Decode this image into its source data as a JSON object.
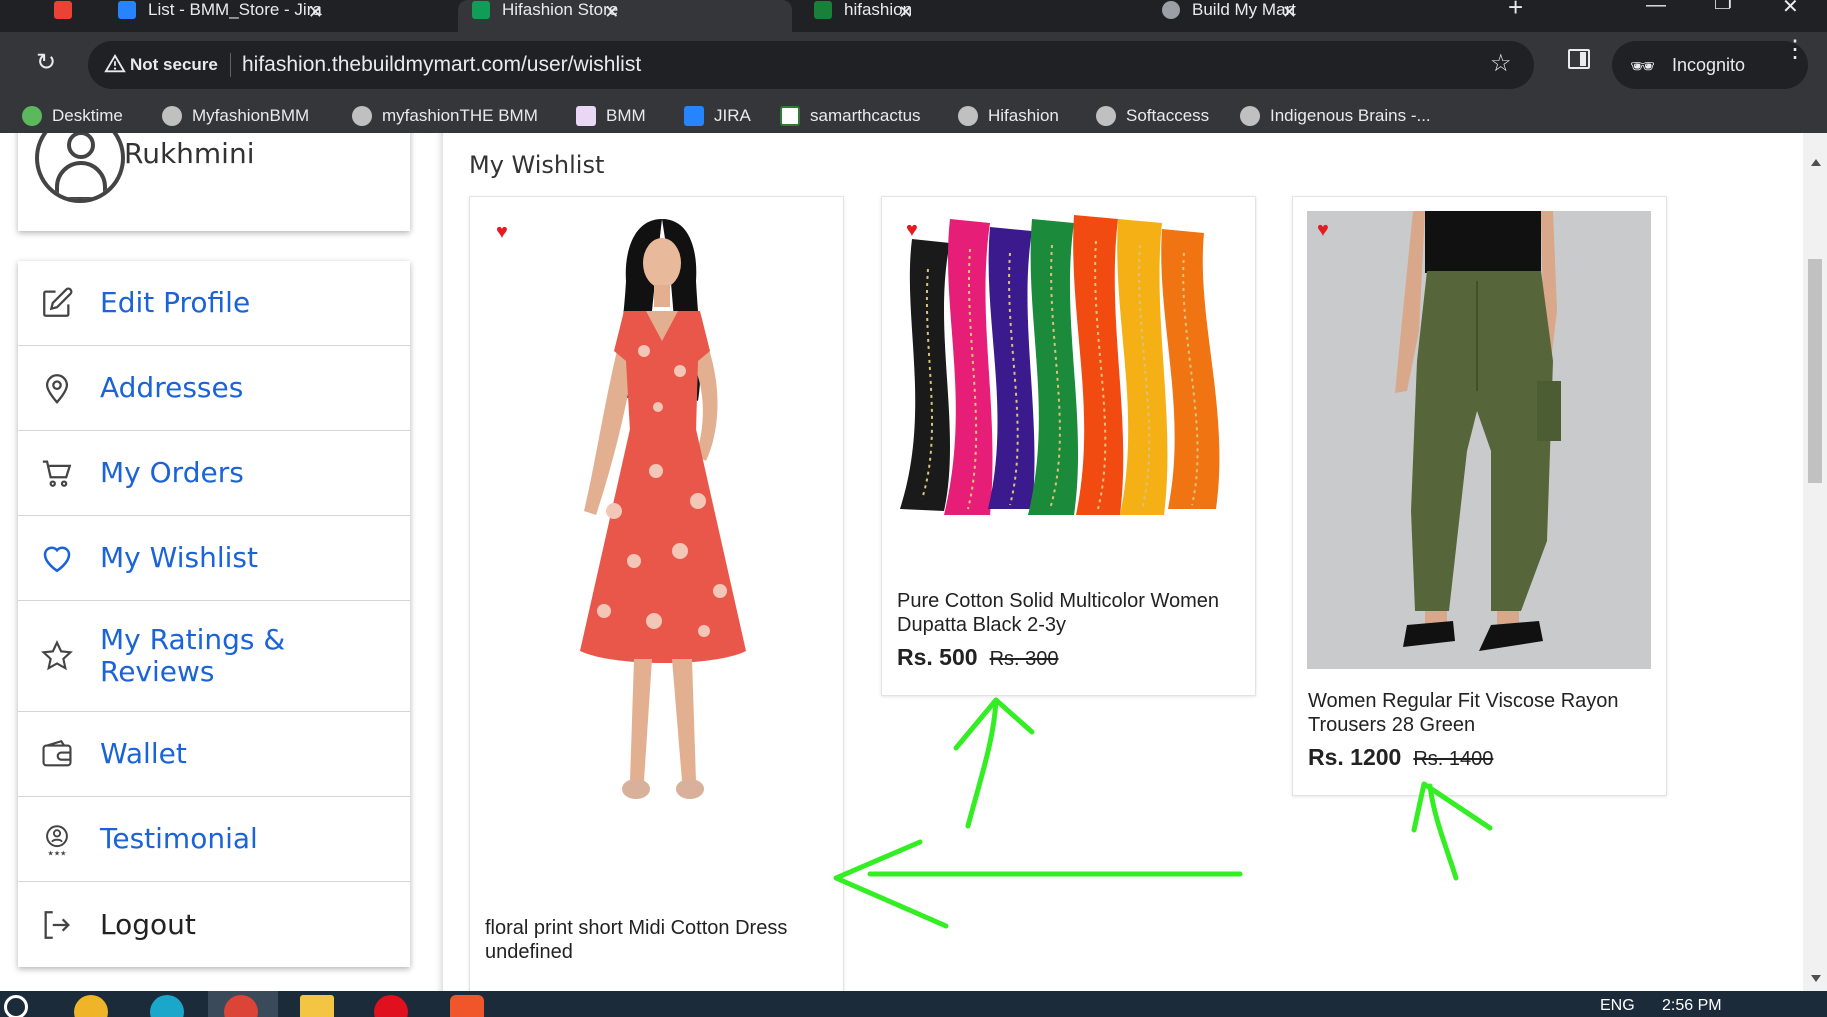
{
  "browser": {
    "tabs": [
      {
        "label": "",
        "icon": "gmail-icon",
        "active": false
      },
      {
        "label": "List - BMM_Store - Jira",
        "icon": "jira-icon",
        "active": false
      },
      {
        "label": "Hifashion Store",
        "icon": "store-icon",
        "active": true
      },
      {
        "label": "hifashion",
        "icon": "sheet-icon",
        "active": false
      },
      {
        "label": "Build My Mart",
        "icon": "globe-icon",
        "active": false
      }
    ],
    "not_secure_label": "Not secure",
    "url": "hifashion.thebuildmymart.com/user/wishlist",
    "incognito_label": "Incognito",
    "bookmarks": [
      {
        "label": "Desktime"
      },
      {
        "label": "MyfashionBMM"
      },
      {
        "label": "myfashionTHE BMM"
      },
      {
        "label": "BMM"
      },
      {
        "label": "JIRA"
      },
      {
        "label": "samarthcactus"
      },
      {
        "label": "Hifashion"
      },
      {
        "label": "Softaccess"
      },
      {
        "label": "Indigenous Brains -..."
      }
    ]
  },
  "profile": {
    "name": "Rukhmini"
  },
  "side_menu": {
    "items": [
      {
        "label": "Edit Profile"
      },
      {
        "label": "Addresses"
      },
      {
        "label": "My Orders"
      },
      {
        "label": "My Wishlist"
      },
      {
        "label": "My Ratings & Reviews"
      },
      {
        "label": "Wallet"
      },
      {
        "label": "Testimonial"
      },
      {
        "label": "Logout"
      }
    ]
  },
  "wishlist": {
    "title": "My Wishlist",
    "items": [
      {
        "name": "floral print short Midi Cotton Dress undefined",
        "price": "",
        "old_price": ""
      },
      {
        "name": "Pure Cotton Solid Multicolor Women Dupatta Black 2-3y",
        "price": "Rs. 500",
        "old_price": "Rs. 300"
      },
      {
        "name": "Women Regular Fit Viscose Rayon Trousers 28 Green",
        "price": "Rs. 1200",
        "old_price": "Rs. 1400"
      }
    ]
  },
  "taskbar": {
    "language": "ENG",
    "time": "2:56 PM"
  },
  "colors": {
    "link_blue": "#1a63d8",
    "heart_red": "#e31b23",
    "annotation_green": "#33ee22"
  }
}
